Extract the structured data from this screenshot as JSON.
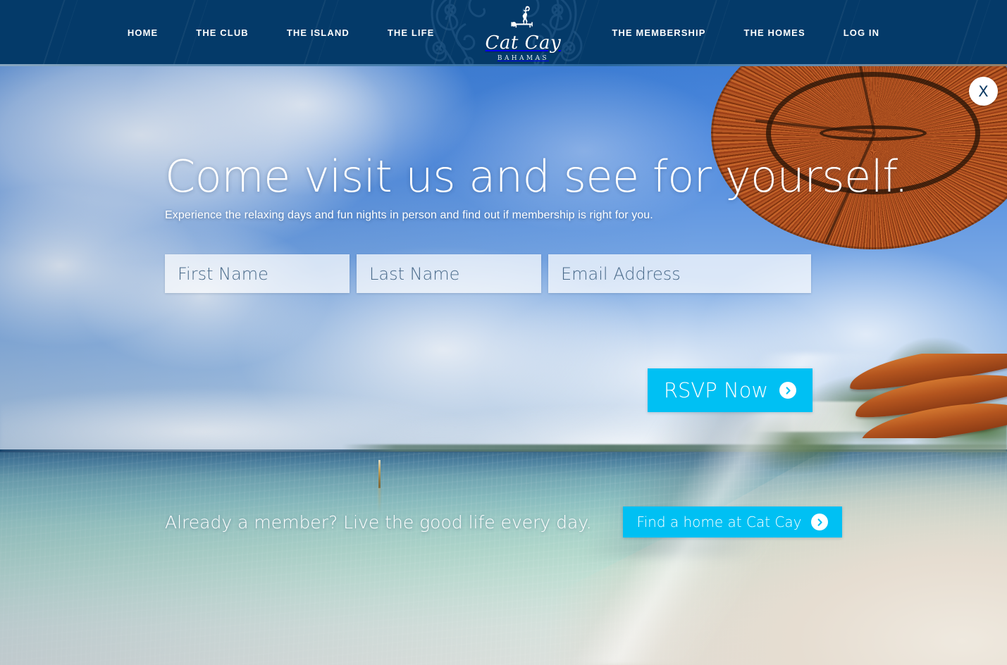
{
  "brand": {
    "name": "Cat Cay",
    "tagline": "BAHAMAS",
    "logo_icon": "cat-on-perch-icon",
    "navy": "#043a69",
    "accent_cyan": "#00c0f3"
  },
  "nav": {
    "left_items": [
      {
        "label": "HOME",
        "name": "nav-home"
      },
      {
        "label": "THE CLUB",
        "name": "nav-the-club"
      },
      {
        "label": "THE ISLAND",
        "name": "nav-the-island"
      },
      {
        "label": "THE LIFE",
        "name": "nav-the-life"
      }
    ],
    "right_items": [
      {
        "label": "THE MEMBERSHIP",
        "name": "nav-the-membership"
      },
      {
        "label": "THE HOMES",
        "name": "nav-the-homes"
      },
      {
        "label": "LOG IN",
        "name": "nav-log-in"
      }
    ]
  },
  "overlay": {
    "close_label": "X"
  },
  "hero": {
    "headline": "Come visit us and see for yourself.",
    "subhead": "Experience the relaxing days and fun nights in person and find out if membership is right for you.",
    "form": {
      "first_name": {
        "placeholder": "First Name",
        "value": ""
      },
      "last_name": {
        "placeholder": "Last Name",
        "value": ""
      },
      "email": {
        "placeholder": "Email Address",
        "value": ""
      },
      "submit_label": "RSVP Now"
    },
    "member_prompt": "Already a member? Live the good life every day.",
    "member_cta_label": "Find a home at Cat Cay"
  }
}
